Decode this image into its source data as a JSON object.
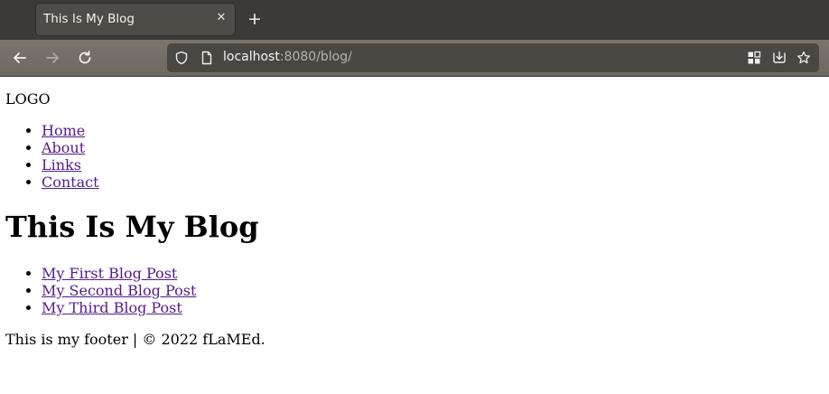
{
  "browser": {
    "tab": {
      "title": "This Is My Blog",
      "close_icon": "close-icon"
    },
    "new_tab_icon": "plus-icon",
    "nav": {
      "back_icon": "arrow-left-icon",
      "forward_icon": "arrow-right-icon",
      "reload_icon": "reload-icon"
    },
    "url": {
      "host": "localhost",
      "rest": ":8080/blog/"
    },
    "toolbar_icons": [
      "extensions-grid-icon",
      "save-to-pocket-icon",
      "bookmark-star-icon"
    ]
  },
  "page": {
    "logo_text": "LOGO",
    "nav_links": [
      {
        "label": "Home"
      },
      {
        "label": "About"
      },
      {
        "label": "Links"
      },
      {
        "label": "Contact"
      }
    ],
    "title": "This Is My Blog",
    "posts": [
      {
        "label": "My First Blog Post"
      },
      {
        "label": "My Second Blog Post"
      },
      {
        "label": "My Third Blog Post"
      }
    ],
    "footer_text": "This is my footer | © 2022 fLaMEd."
  },
  "colors": {
    "visited_link": "#551a8b",
    "tabbar_bg": "#3c3a37",
    "navbar_bg": "#746e68",
    "urlbar_bg": "#4a4642"
  }
}
